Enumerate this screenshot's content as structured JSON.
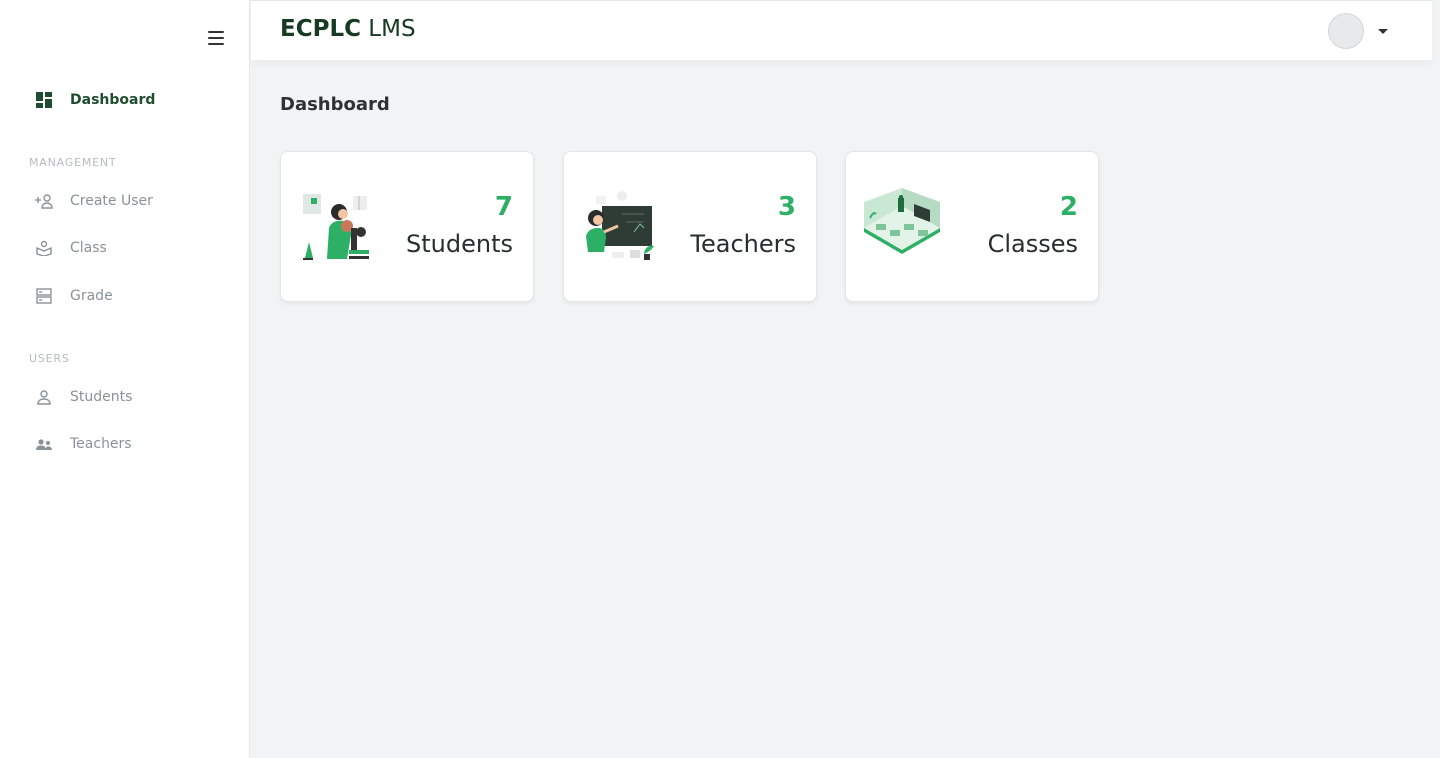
{
  "brand": {
    "bold": "ECPLC",
    "light": "LMS"
  },
  "sidebar": {
    "dashboard_label": "Dashboard",
    "sections": [
      {
        "label": "MANAGEMENT",
        "items": [
          {
            "label": "Create User"
          },
          {
            "label": "Class"
          },
          {
            "label": "Grade"
          }
        ]
      },
      {
        "label": "USERS",
        "items": [
          {
            "label": "Students"
          },
          {
            "label": "Teachers"
          }
        ]
      }
    ]
  },
  "main": {
    "title": "Dashboard",
    "cards": [
      {
        "count": "7",
        "label": "Students"
      },
      {
        "count": "3",
        "label": "Teachers"
      },
      {
        "count": "2",
        "label": "Classes"
      }
    ]
  },
  "colors": {
    "accent": "#2eaf66",
    "brand_dark": "#163a22",
    "sidebar_text": "#8a9299"
  }
}
